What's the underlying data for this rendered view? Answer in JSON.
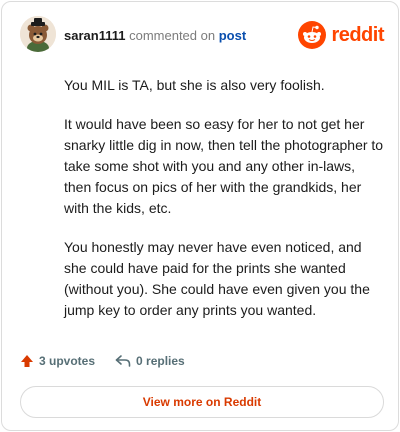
{
  "header": {
    "username": "saran1111",
    "commented_on": "commented on",
    "post_link": "post",
    "brand": "reddit"
  },
  "comment": {
    "paragraphs": [
      "You MIL is TA, but she is also very foolish.",
      "It would have been so easy for her to not get her snarky little dig in now, then tell the photographer to take some shot with you and any other in-laws, then focus on pics of her with the grandkids, her with the kids, etc.",
      "You honestly may never have even noticed, and she could have paid for the prints she wanted (without you). She could have even given you the jump key to order any prints you wanted."
    ]
  },
  "actions": {
    "upvotes": "3 upvotes",
    "replies": "0 replies"
  },
  "footer": {
    "view_more": "View more on Reddit"
  },
  "icons": {
    "avatar": "user-avatar",
    "brand_logo": "reddit-logo-icon",
    "upvote": "upvote-arrow-icon",
    "reply": "reply-arrow-icon"
  },
  "colors": {
    "brand": "#ff4500",
    "link": "#0a4fae",
    "upvote_arrow": "#d93a00",
    "muted": "#576f76"
  }
}
